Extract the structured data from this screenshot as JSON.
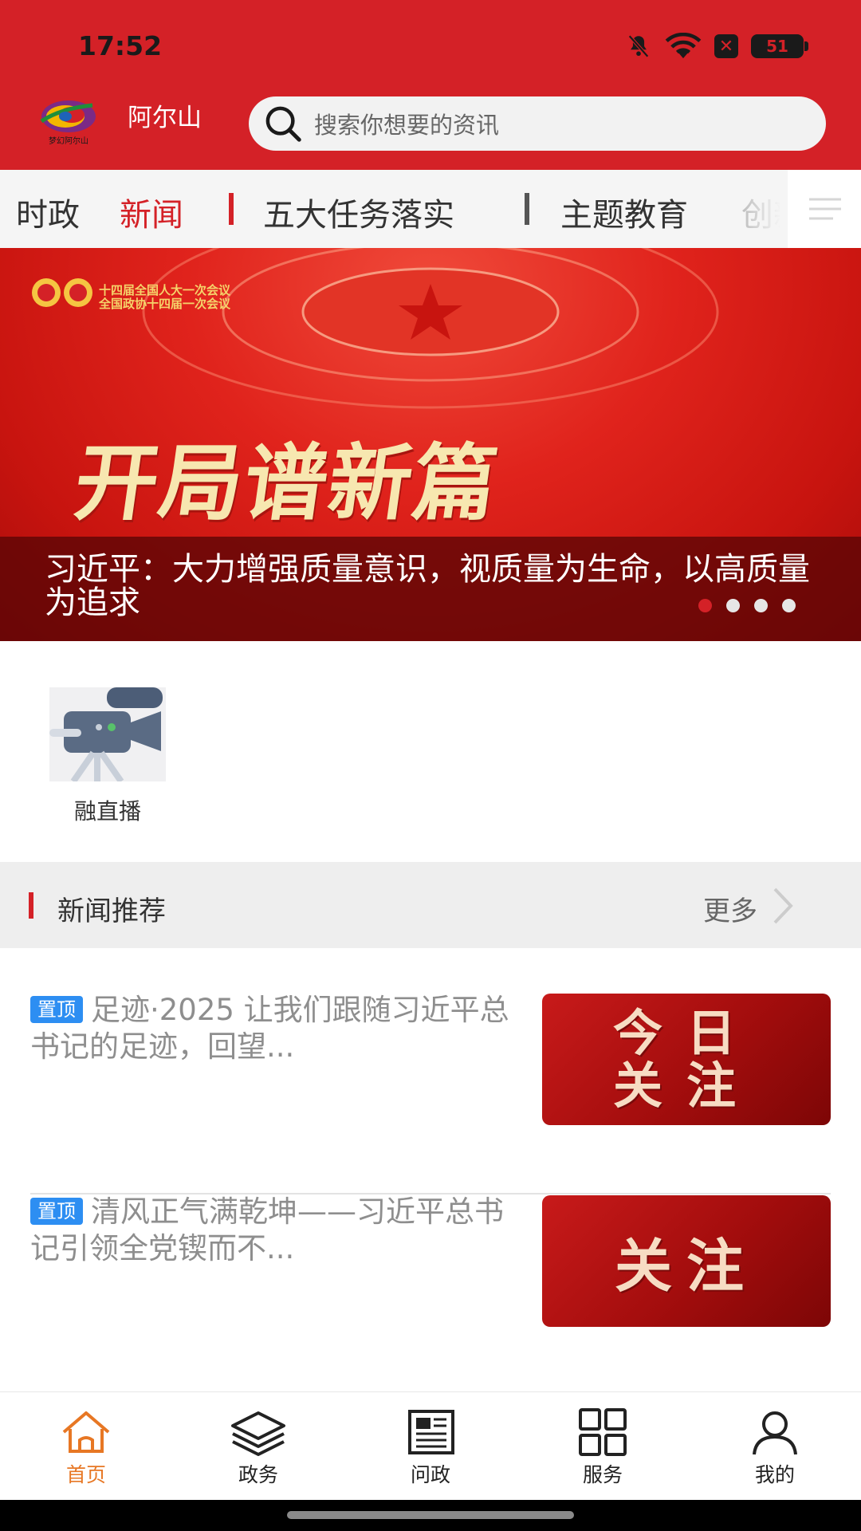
{
  "status_bar": {
    "time": "17:52",
    "battery": "51"
  },
  "header": {
    "logo_caption": "梦幻阿尔山",
    "city_name": "阿尔山",
    "search_placeholder": "搜索你想要的资讯"
  },
  "tabs": [
    {
      "label": "时政",
      "active": false
    },
    {
      "label": "新闻",
      "active": true
    },
    {
      "label": "五大任务落实",
      "active": false
    },
    {
      "label": "主题教育",
      "active": false
    },
    {
      "label": "创新",
      "active": false
    }
  ],
  "banner": {
    "conference_line1": "十四届全国人大一次会议",
    "conference_line2": "全国政协十四届一次会议",
    "slogan": "开局谱新篇",
    "title": "习近平：大力增强质量意识，视质量为生命，以高质量为追求",
    "slide_count": 4,
    "active_slide": 1
  },
  "quick_entries": [
    {
      "label": "融直播",
      "icon": "video-camera-icon"
    }
  ],
  "section": {
    "title": "新闻推荐",
    "more": "更多"
  },
  "news": [
    {
      "badge": "置顶",
      "title": "足迹·2025 让我们跟随习近平总书记的足迹，回望...",
      "thumb_text": "今日\n关注"
    },
    {
      "badge": "置顶",
      "title": "清风正气满乾坤——习近平总书记引领全党锲而不...",
      "thumb_text": "关注"
    }
  ],
  "bottom_nav": [
    {
      "label": "首页",
      "icon": "home-icon",
      "active": true
    },
    {
      "label": "政务",
      "icon": "layers-icon",
      "active": false
    },
    {
      "label": "问政",
      "icon": "newspaper-icon",
      "active": false
    },
    {
      "label": "服务",
      "icon": "grid-icon",
      "active": false
    },
    {
      "label": "我的",
      "icon": "user-icon",
      "active": false
    }
  ],
  "colors": {
    "brand_red": "#d42127",
    "active_nav": "#e77724",
    "pin_badge": "#2d8ef2"
  }
}
